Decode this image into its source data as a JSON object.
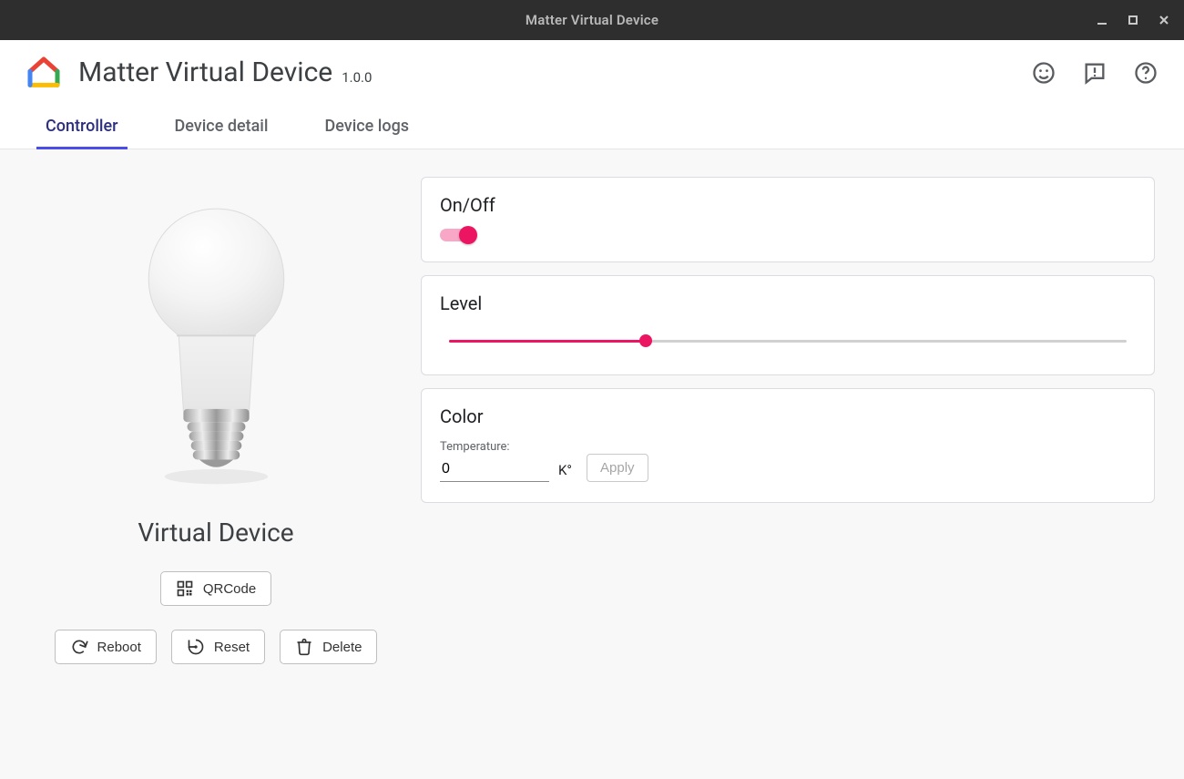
{
  "window_title": "Matter Virtual Device",
  "app": {
    "title": "Matter Virtual Device",
    "version": "1.0.0"
  },
  "header_icons": {
    "feedback_sentiment": "smiley-icon",
    "feedback_message": "message-alert-icon",
    "help": "help-icon"
  },
  "tabs": [
    {
      "label": "Controller",
      "active": true
    },
    {
      "label": "Device detail",
      "active": false
    },
    {
      "label": "Device logs",
      "active": false
    }
  ],
  "device": {
    "name": "Virtual Device",
    "buttons": {
      "qrcode": "QRCode",
      "reboot": "Reboot",
      "reset": "Reset",
      "delete": "Delete"
    }
  },
  "panels": {
    "onoff": {
      "title": "On/Off",
      "on": true
    },
    "level": {
      "title": "Level",
      "value_pct": 29
    },
    "color": {
      "title": "Color",
      "temp_label": "Temperature:",
      "temp_value": "0",
      "unit": "K°",
      "apply_label": "Apply"
    }
  },
  "colors": {
    "accent_pink": "#ec1561"
  }
}
